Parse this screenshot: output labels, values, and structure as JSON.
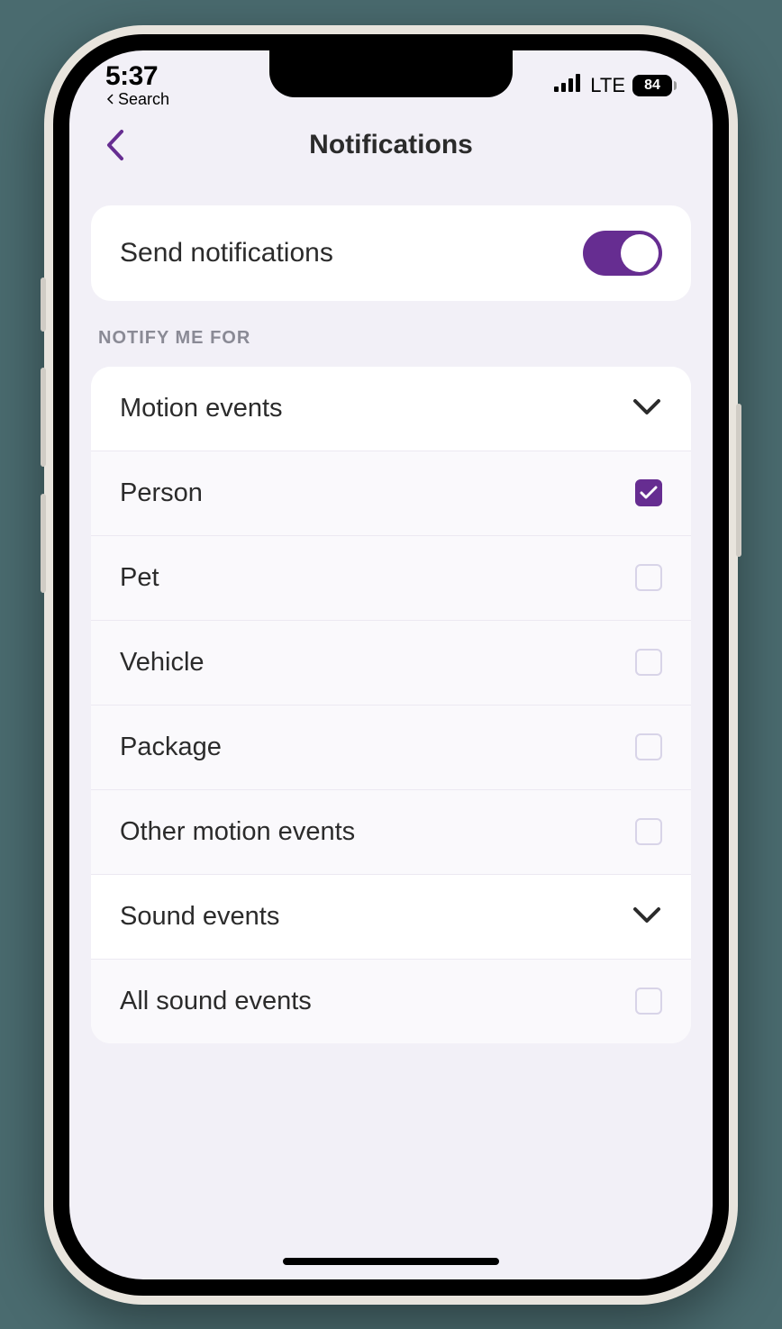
{
  "statusBar": {
    "time": "5:37",
    "breadcrumb": "Search",
    "network": "LTE",
    "battery": "84"
  },
  "header": {
    "title": "Notifications"
  },
  "toggleCard": {
    "label": "Send notifications",
    "enabled": true
  },
  "sectionHeader": "NOTIFY ME FOR",
  "groups": [
    {
      "title": "Motion events",
      "items": [
        {
          "label": "Person",
          "checked": true
        },
        {
          "label": "Pet",
          "checked": false
        },
        {
          "label": "Vehicle",
          "checked": false
        },
        {
          "label": "Package",
          "checked": false
        },
        {
          "label": "Other motion events",
          "checked": false
        }
      ]
    },
    {
      "title": "Sound events",
      "items": [
        {
          "label": "All sound events",
          "checked": false
        }
      ]
    }
  ],
  "colors": {
    "accent": "#662d91",
    "background": "#f2f0f7"
  }
}
